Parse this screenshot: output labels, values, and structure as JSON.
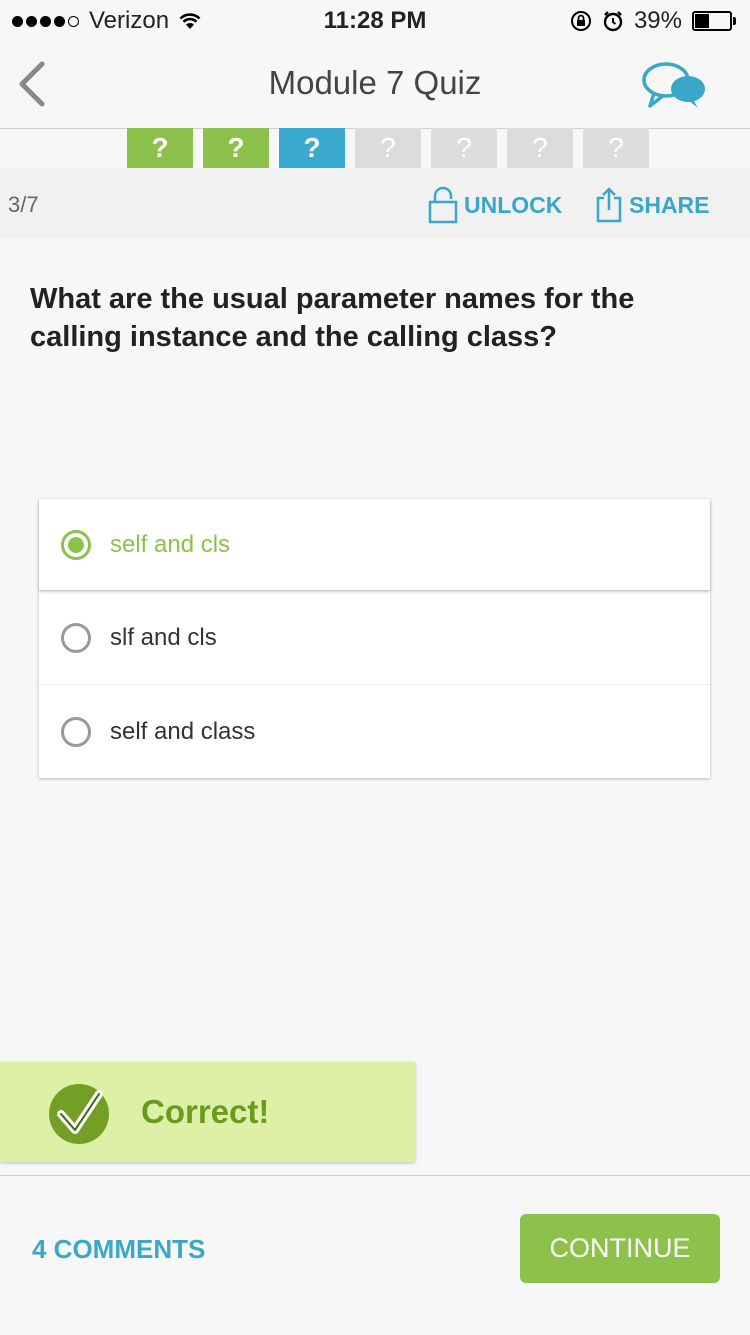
{
  "status_bar": {
    "carrier": "Verizon",
    "time": "11:28 PM",
    "battery": "39%",
    "battery_level": 0.39
  },
  "nav": {
    "title": "Module 7 Quiz",
    "back_icon": "chevron-left-icon",
    "chat_icon": "chat-bubbles-icon"
  },
  "progress": {
    "items": [
      {
        "label": "?",
        "state": "answered"
      },
      {
        "label": "?",
        "state": "answered"
      },
      {
        "label": "?",
        "state": "current"
      },
      {
        "label": "?",
        "state": "pending"
      },
      {
        "label": "?",
        "state": "pending"
      },
      {
        "label": "?",
        "state": "pending"
      },
      {
        "label": "?",
        "state": "pending"
      }
    ]
  },
  "meta": {
    "counter": "3/7",
    "unlock_label": "UNLOCK",
    "share_label": "SHARE"
  },
  "question": {
    "text": "What are the usual parameter names for the calling instance and the calling class?"
  },
  "answers": [
    {
      "text": "self and cls",
      "selected": true
    },
    {
      "text": "slf and cls",
      "selected": false
    },
    {
      "text": "self and class",
      "selected": false
    }
  ],
  "feedback": {
    "text": "Correct!"
  },
  "footer": {
    "comments_label": "4 COMMENTS",
    "continue_label": "CONTINUE"
  },
  "colors": {
    "green": "#8cc14c",
    "blue": "#39a9cf",
    "gray": "#dcdcdc",
    "feedback_bg": "#def0a6"
  }
}
